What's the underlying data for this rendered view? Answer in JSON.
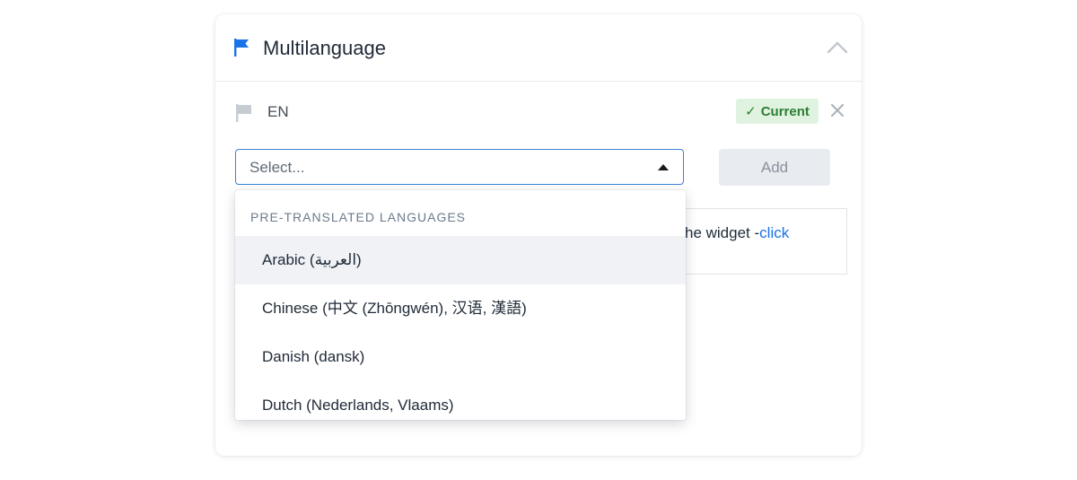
{
  "panel": {
    "title": "Multilanguage",
    "icon": "flag-icon",
    "accent_color": "#1a73e8"
  },
  "language_row": {
    "code": "EN",
    "badge_check": "✓",
    "badge_label": "Current",
    "badge_color": "#2e7d32"
  },
  "selector": {
    "placeholder": "Select...",
    "add_label": "Add"
  },
  "info": {
    "text": "he widget -",
    "link": "click"
  },
  "dropdown": {
    "group_label": "PRE-TRANSLATED LANGUAGES",
    "options": [
      {
        "label": "Arabic (العربية)"
      },
      {
        "label": "Chinese (中文 (Zhōngwén), 汉语, 漢語)"
      },
      {
        "label": "Danish (dansk)"
      },
      {
        "label": "Dutch (Nederlands, Vlaams)"
      }
    ]
  }
}
